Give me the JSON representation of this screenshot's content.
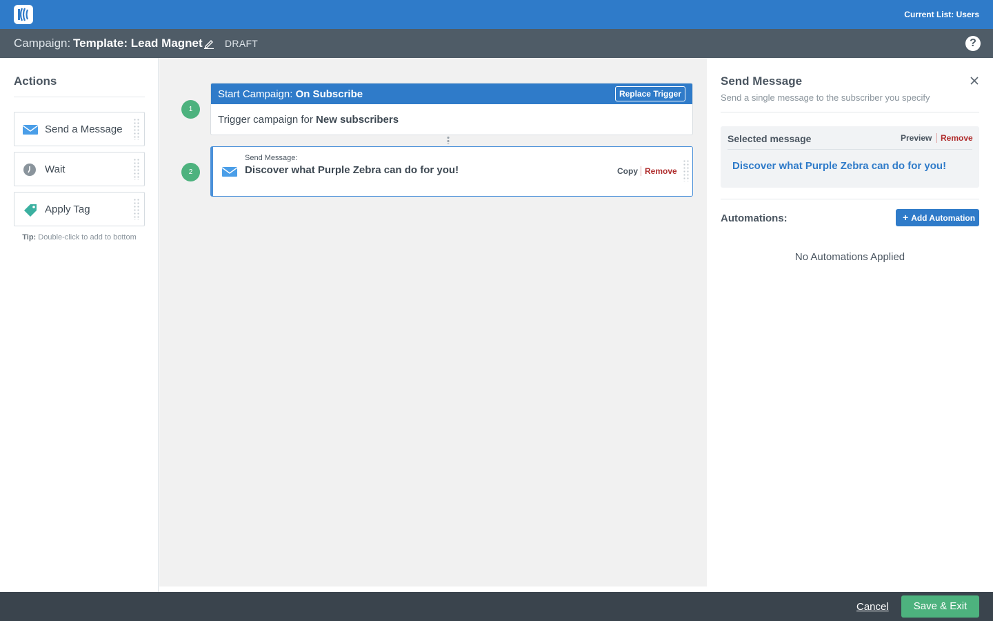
{
  "topbar": {
    "logo_icon": "app-logo-icon",
    "current_list": "Current List: Users",
    "color": "#2f7bc9"
  },
  "campaign": {
    "prefix": "Campaign:",
    "name": "Template: Lead Magnet",
    "edit_icon": "pencil-icon",
    "status": "DRAFT",
    "help_icon": "question-circle-icon"
  },
  "actions": {
    "title": "Actions",
    "items": [
      {
        "label": "Send a Message",
        "icon": "envelope-icon"
      },
      {
        "label": "Wait",
        "icon": "clock-icon"
      },
      {
        "label": "Apply Tag",
        "icon": "tag-icon"
      }
    ],
    "tip_label": "Tip:",
    "tip_text": "Double-click to add to bottom"
  },
  "workflow": {
    "steps": [
      {
        "number": "1",
        "prefix": "Start Campaign:",
        "trigger_name": "On Subscribe",
        "button": "Replace Trigger",
        "body_prefix": "Trigger campaign for",
        "body_value": "New subscribers"
      },
      {
        "number": "2",
        "kicker": "Send Message:",
        "title": "Discover what Purple Zebra can do for you!",
        "copy": "Copy",
        "remove": "Remove"
      }
    ]
  },
  "side_panel": {
    "title": "Send Message",
    "subtitle": "Send a single message to the subscriber you specify",
    "selected_label": "Selected message",
    "preview": "Preview",
    "remove": "Remove",
    "selected_message": "Discover what Purple Zebra can do for you!",
    "automations_label": "Automations:",
    "add_automation": "Add Automation",
    "empty_text": "No Automations Applied"
  },
  "footer": {
    "cancel": "Cancel",
    "save": "Save & Exit"
  },
  "colors": {
    "primary": "#2f7bc9",
    "success": "#4db27e",
    "danger": "#b02e2e",
    "header_dark": "#4f5c67",
    "footer_dark": "#3a444d"
  }
}
